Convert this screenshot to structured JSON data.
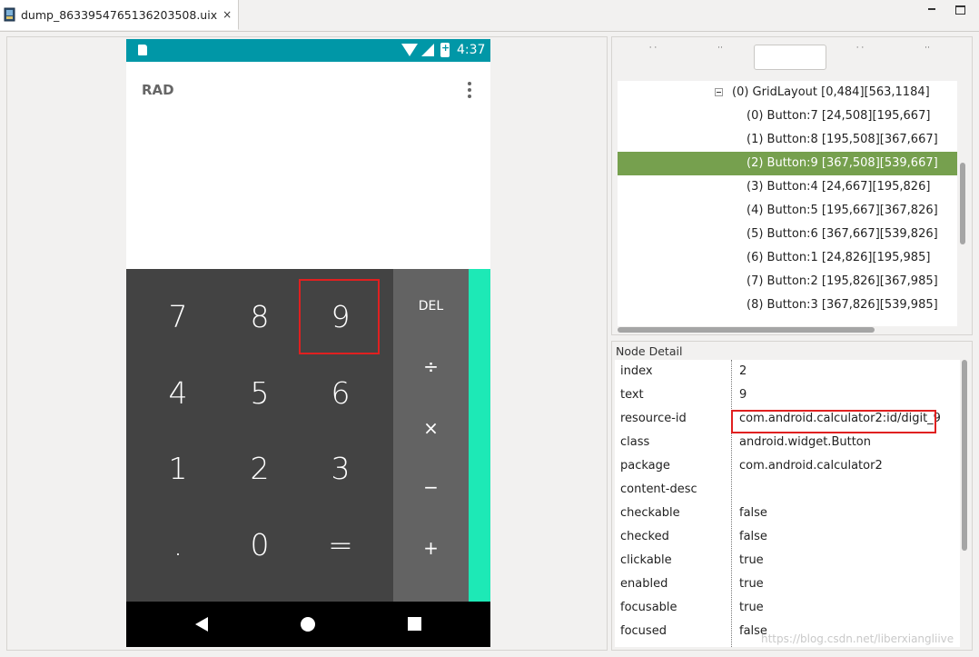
{
  "editor_tab": {
    "title": "dump_8633954765136203508.uix",
    "close_icon": "×"
  },
  "device": {
    "status_bar": {
      "time": "4:37",
      "background": "#0097a7"
    },
    "display": {
      "mode_label": "RAD"
    },
    "keypad": {
      "digits": [
        "7",
        "8",
        "9",
        "4",
        "5",
        "6",
        "1",
        "2",
        "3",
        ".",
        "0",
        "="
      ],
      "highlighted_key": "9",
      "operators": [
        "DEL",
        "÷",
        "×",
        "−",
        "+"
      ]
    },
    "colors": {
      "keypad": "#434343",
      "operators": "#636363",
      "advanced_strip": "#1de9b6"
    }
  },
  "hierarchy": {
    "toolbar": {
      "filter_value": ""
    },
    "rows": [
      "(0) GridLayout [0,484][563,1184]",
      "(0) Button:7 [24,508][195,667]",
      "(1) Button:8 [195,508][367,667]",
      "(2) Button:9 [367,508][539,667]",
      "(3) Button:4 [24,667][195,826]",
      "(4) Button:5 [195,667][367,826]",
      "(5) Button:6 [367,667][539,826]",
      "(6) Button:1 [24,826][195,985]",
      "(7) Button:2 [195,826][367,985]",
      "(8) Button:3 [367,826][539,985]"
    ],
    "selected_index": 3,
    "selection_color": "#76a04e"
  },
  "node_detail": {
    "title": "Node Detail",
    "properties": [
      {
        "key": "index",
        "value": "2"
      },
      {
        "key": "text",
        "value": "9"
      },
      {
        "key": "resource-id",
        "value": "com.android.calculator2:id/digit_9"
      },
      {
        "key": "class",
        "value": "android.widget.Button"
      },
      {
        "key": "package",
        "value": "com.android.calculator2"
      },
      {
        "key": "content-desc",
        "value": ""
      },
      {
        "key": "checkable",
        "value": "false"
      },
      {
        "key": "checked",
        "value": "false"
      },
      {
        "key": "clickable",
        "value": "true"
      },
      {
        "key": "enabled",
        "value": "true"
      },
      {
        "key": "focusable",
        "value": "true"
      },
      {
        "key": "focused",
        "value": "false"
      }
    ],
    "highlighted_key": "resource-id"
  },
  "watermark": "https://blog.csdn.net/liberxiangliive"
}
